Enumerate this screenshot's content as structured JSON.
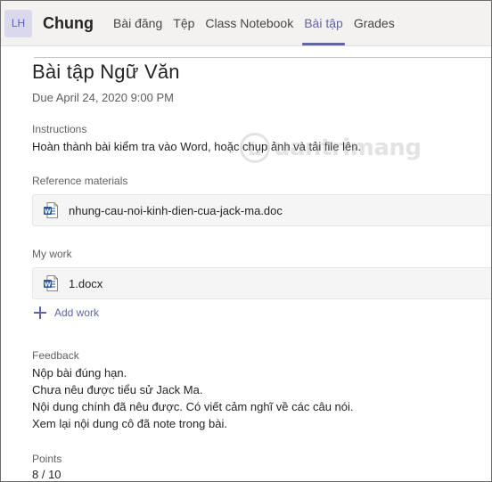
{
  "header": {
    "avatar_initials": "LH",
    "team_name": "Chung",
    "tabs": [
      {
        "label": "Bài đăng",
        "active": false
      },
      {
        "label": "Tệp",
        "active": false
      },
      {
        "label": "Class Notebook",
        "active": false
      },
      {
        "label": "Bài tập",
        "active": true
      },
      {
        "label": "Grades",
        "active": false
      }
    ]
  },
  "assignment": {
    "title": "Bài tập Ngữ Văn",
    "due": "Due April 24, 2020 9:00 PM",
    "instructions_label": "Instructions",
    "instructions_text": "Hoàn thành bài kiểm tra vào Word, hoặc chụp ảnh và tải file lên.",
    "reference_label": "Reference materials",
    "reference_file": "nhung-cau-noi-kinh-dien-cua-jack-ma.doc",
    "mywork_label": "My work",
    "mywork_file": "1.docx",
    "add_work_label": "Add work",
    "feedback_label": "Feedback",
    "feedback_lines": [
      "Nộp bài đúng hạn.",
      "Chưa nêu được tiểu sử Jack Ma.",
      "Nội dung chính đã nêu được. Có viết cảm nghĩ về các câu nói.",
      "Xem lại nội dung cô đã note trong bài."
    ],
    "points_label": "Points",
    "points_value": "8 / 10"
  },
  "watermark": {
    "text": "uantrimang"
  },
  "colors": {
    "accent": "#6264a7",
    "word_blue": "#2b579a"
  }
}
